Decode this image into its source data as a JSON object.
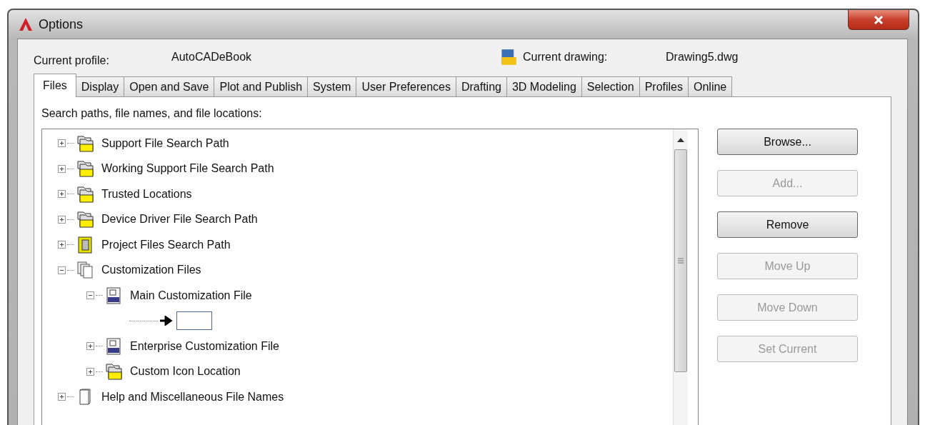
{
  "window": {
    "title": "Options"
  },
  "profile": {
    "label": "Current profile:",
    "value": "AutoCADeBook"
  },
  "drawing": {
    "label": "Current drawing:",
    "value": "Drawing5.dwg"
  },
  "tabs": [
    {
      "label": "Files",
      "selected": true
    },
    {
      "label": "Display",
      "selected": false
    },
    {
      "label": "Open and Save",
      "selected": false
    },
    {
      "label": "Plot and Publish",
      "selected": false
    },
    {
      "label": "System",
      "selected": false
    },
    {
      "label": "User Preferences",
      "selected": false
    },
    {
      "label": "Drafting",
      "selected": false
    },
    {
      "label": "3D Modeling",
      "selected": false
    },
    {
      "label": "Selection",
      "selected": false
    },
    {
      "label": "Profiles",
      "selected": false
    },
    {
      "label": "Online",
      "selected": false
    }
  ],
  "tree_label": "Search paths, file names, and file locations:",
  "tree": [
    {
      "label": "Support File Search Path",
      "kind": "folder",
      "expanded": false
    },
    {
      "label": "Working Support File Search Path",
      "kind": "folder",
      "expanded": false
    },
    {
      "label": "Trusted Locations",
      "kind": "folder",
      "expanded": false
    },
    {
      "label": "Device Driver File Search Path",
      "kind": "folder",
      "expanded": false
    },
    {
      "label": "Project Files Search Path",
      "kind": "project",
      "expanded": false
    },
    {
      "label": "Customization Files",
      "kind": "files",
      "expanded": true,
      "children": [
        {
          "label": "Main Customization File",
          "kind": "cui",
          "expanded": true,
          "children": [
            {
              "kind": "entry"
            }
          ]
        },
        {
          "label": "Enterprise Customization File",
          "kind": "cui",
          "expanded": false
        },
        {
          "label": "Custom Icon Location",
          "kind": "folder",
          "expanded": false
        }
      ]
    },
    {
      "label": "Help and Miscellaneous File Names",
      "kind": "doc",
      "expanded": false
    }
  ],
  "buttons": [
    {
      "label": "Browse...",
      "disabled": false
    },
    {
      "label": "Add...",
      "disabled": true
    },
    {
      "label": "Remove",
      "disabled": false
    },
    {
      "label": "Move Up",
      "disabled": true
    },
    {
      "label": "Move Down",
      "disabled": true
    },
    {
      "label": "Set Current",
      "disabled": true
    }
  ]
}
